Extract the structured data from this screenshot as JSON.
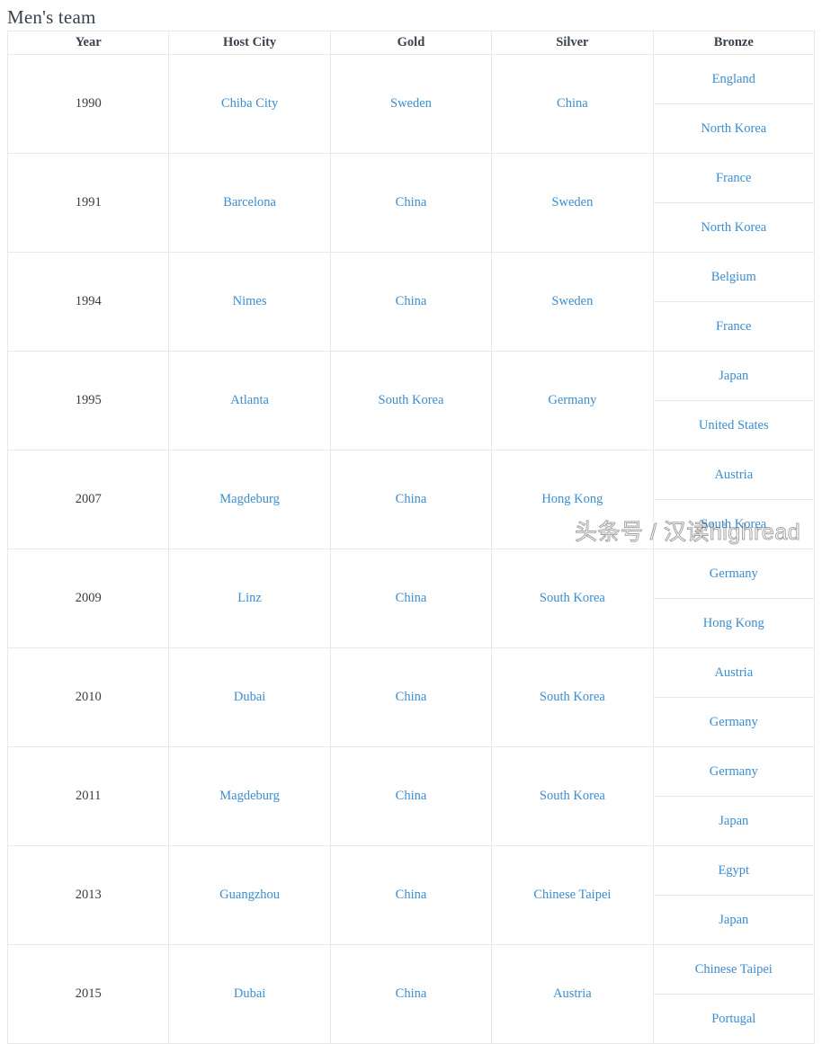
{
  "page": {
    "title": "Men's team"
  },
  "table": {
    "columns": [
      "Year",
      "Host City",
      "Gold",
      "Silver",
      "Bronze"
    ],
    "rows": [
      {
        "year": "1990",
        "host_city": "Chiba City",
        "gold": "Sweden",
        "silver": "China",
        "bronze": [
          "England",
          "North Korea"
        ]
      },
      {
        "year": "1991",
        "host_city": "Barcelona",
        "gold": "China",
        "silver": "Sweden",
        "bronze": [
          "France",
          "North Korea"
        ]
      },
      {
        "year": "1994",
        "host_city": "Nimes",
        "gold": "China",
        "silver": "Sweden",
        "bronze": [
          "Belgium",
          "France"
        ]
      },
      {
        "year": "1995",
        "host_city": "Atlanta",
        "gold": "South Korea",
        "silver": "Germany",
        "bronze": [
          "Japan",
          "United States"
        ]
      },
      {
        "year": "2007",
        "host_city": "Magdeburg",
        "gold": "China",
        "silver": "Hong Kong",
        "bronze": [
          "Austria",
          "South Korea"
        ]
      },
      {
        "year": "2009",
        "host_city": "Linz",
        "gold": "China",
        "silver": "South Korea",
        "bronze": [
          "Germany",
          "Hong Kong"
        ]
      },
      {
        "year": "2010",
        "host_city": "Dubai",
        "gold": "China",
        "silver": "South Korea",
        "bronze": [
          "Austria",
          "Germany"
        ]
      },
      {
        "year": "2011",
        "host_city": "Magdeburg",
        "gold": "China",
        "silver": "South Korea",
        "bronze": [
          "Germany",
          "Japan"
        ]
      },
      {
        "year": "2013",
        "host_city": "Guangzhou",
        "gold": "China",
        "silver": "Chinese Taipei",
        "bronze": [
          "Egypt",
          "Japan"
        ]
      },
      {
        "year": "2015",
        "host_city": "Dubai",
        "gold": "China",
        "silver": "Austria",
        "bronze": [
          "Chinese Taipei",
          "Portugal"
        ]
      }
    ]
  },
  "watermark": {
    "text": "头条号 / 汉读highread"
  },
  "colors": {
    "link": "#3b8dd0",
    "header_text": "#3a4250",
    "border": "#e8e8e8"
  }
}
